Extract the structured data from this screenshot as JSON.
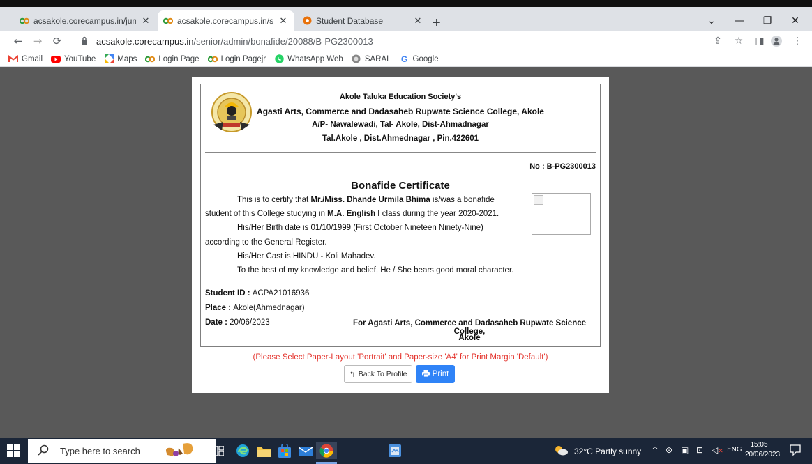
{
  "tabs": [
    {
      "title": "acsakole.corecampus.in/junior/a",
      "active": false
    },
    {
      "title": "acsakole.corecampus.in/senior/a",
      "active": true
    },
    {
      "title": "Student Database",
      "active": false
    }
  ],
  "address": {
    "host": "acsakole.corecampus.in",
    "path": "/senior/admin/bonafide/20088/B-PG2300013"
  },
  "bookmarks": [
    {
      "label": "Gmail",
      "icon": "gmail-icon"
    },
    {
      "label": "YouTube",
      "icon": "youtube-icon"
    },
    {
      "label": "Maps",
      "icon": "maps-icon"
    },
    {
      "label": "Login Page",
      "icon": "corecampus-icon"
    },
    {
      "label": "Login Pagejr",
      "icon": "corecampus-icon"
    },
    {
      "label": "WhatsApp Web",
      "icon": "whatsapp-icon"
    },
    {
      "label": "SARAL",
      "icon": "saral-icon"
    },
    {
      "label": "Google",
      "icon": "google-icon"
    }
  ],
  "certificate": {
    "society": "Akole Taluka Education Society's",
    "college": "Agasti Arts, Commerce and Dadasaheb Rupwate Science College, Akole",
    "address1": "A/P- Nawalewadi, Tal- Akole, Dist-Ahmadnagar",
    "address2": "Tal.Akole , Dist.Ahmednagar , Pin.422601",
    "number": "No : B-PG2300013",
    "title": "Bonafide Certificate",
    "line1_pre": "This is to certify that ",
    "line1_name": "Mr./Miss. Dhande Urmila Bhima",
    "line1_post": " is/was a bonafide",
    "line2_pre": "student of this College studying in ",
    "line2_class": "M.A. English I",
    "line2_post": " class during the year 2020-2021.",
    "line3": "His/Her Birth date is 01/10/1999 (First October Nineteen Ninety-Nine)",
    "line4": "according to the General Register.",
    "line5": "His/Her Cast is HINDU - Koli Mahadev.",
    "line6": "To the best of my knowledge and belief, He / She bears good moral character.",
    "student_id_label": "Student ID : ",
    "student_id": "ACPA21016936",
    "place_label": "Place : ",
    "place": "Akole(Ahmednagar)",
    "date_label": "Date : ",
    "date": "20/06/2023",
    "sign_line1": "For Agasti Arts, Commerce and Dadasaheb Rupwate Science College,",
    "sign_line2": "Akole"
  },
  "notice": "(Please Select Paper-Layout 'Portrait' and Paper-size 'A4' for Print Margin 'Default')",
  "buttons": {
    "back": "Back To Profile",
    "print": "Print"
  },
  "taskbar": {
    "search_placeholder": "Type here to search",
    "weather": "32°C  Partly sunny",
    "lang": "ENG",
    "time": "15:05",
    "date": "20/06/2023"
  },
  "colors": {
    "print_button": "#2f83f7",
    "notice": "#e4322b",
    "page_bg": "#595959"
  }
}
